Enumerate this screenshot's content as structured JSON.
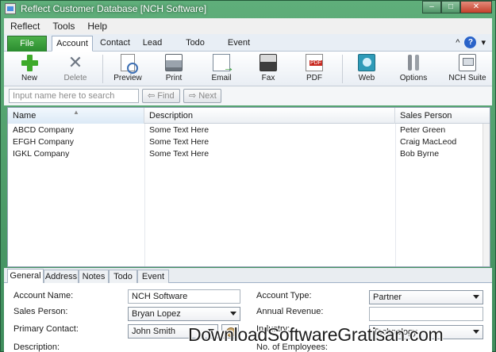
{
  "window": {
    "title": "Reflect Customer Database [NCH Software]",
    "controls": {
      "minimize": "–",
      "maximize": "□",
      "close": "✕"
    }
  },
  "menubar": {
    "items": [
      "Reflect",
      "Tools",
      "Help"
    ]
  },
  "ribbon": {
    "file_label": "File",
    "tabs": [
      "Account",
      "Contact",
      "Lead",
      "Todo",
      "Event"
    ],
    "active_tab": "Account",
    "help_label": "?",
    "collapse_label": "^",
    "dropdown_label": "▾"
  },
  "toolbar": {
    "buttons": [
      {
        "label": "New",
        "icon": "plus-icon"
      },
      {
        "label": "Delete",
        "icon": "delete-icon",
        "disabled": true
      },
      {
        "label": "Preview",
        "icon": "preview-icon"
      },
      {
        "label": "Print",
        "icon": "printer-icon"
      },
      {
        "label": "Email",
        "icon": "email-icon"
      },
      {
        "label": "Fax",
        "icon": "fax-icon"
      },
      {
        "label": "PDF",
        "icon": "pdf-icon"
      },
      {
        "label": "Web",
        "icon": "web-icon"
      },
      {
        "label": "Options",
        "icon": "options-icon"
      },
      {
        "label": "NCH Suite",
        "icon": "nch-suite-icon"
      }
    ]
  },
  "search": {
    "placeholder": "Input name here to search",
    "value": "",
    "find_label": "Find",
    "next_label": "Next"
  },
  "table": {
    "columns": [
      "Name",
      "Description",
      "Sales Person"
    ],
    "rows": [
      [
        "ABCD Company",
        "Some Text Here",
        "Peter Green"
      ],
      [
        "EFGH Company",
        "Some Text Here",
        "Craig MacLeod"
      ],
      [
        "IGKL Company",
        "Some Text Here",
        "Bob Byrne"
      ]
    ]
  },
  "detail_tabs": {
    "items": [
      "General",
      "Address",
      "Notes",
      "Todo",
      "Event"
    ],
    "active": "General"
  },
  "form": {
    "account_name_label": "Account Name:",
    "account_name_value": "NCH Software",
    "sales_person_label": "Sales Person:",
    "sales_person_value": "Bryan Lopez",
    "primary_contact_label": "Primary Contact:",
    "primary_contact_value": "John Smith",
    "description_label": "Description:",
    "account_type_label": "Account Type:",
    "account_type_value": "Partner",
    "annual_revenue_label": "Annual Revenue:",
    "annual_revenue_value": "",
    "industry_label": "Industry:",
    "industry_value": "Technology",
    "employees_label": "No. of Employees:"
  },
  "watermark": "DownloadSoftwareGratisan.com"
}
